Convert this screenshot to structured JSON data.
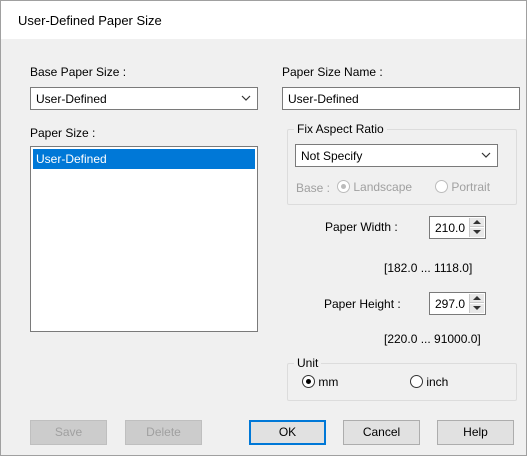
{
  "dialog": {
    "title": "User-Defined Paper Size"
  },
  "base_paper_size": {
    "label": "Base Paper Size :",
    "selected": "User-Defined"
  },
  "paper_size": {
    "label": "Paper Size :",
    "items": [
      "User-Defined"
    ]
  },
  "paper_size_name": {
    "label": "Paper Size Name :",
    "value": "User-Defined"
  },
  "fix_aspect_ratio": {
    "title": "Fix Aspect Ratio",
    "selected": "Not Specify",
    "base_label": "Base :",
    "landscape_label": "Landscape",
    "portrait_label": "Portrait"
  },
  "paper_width": {
    "label": "Paper Width :",
    "value": "210.0",
    "range": "[182.0 ... 1118.0]"
  },
  "paper_height": {
    "label": "Paper Height :",
    "value": "297.0",
    "range": "[220.0 ... 91000.0]"
  },
  "unit": {
    "title": "Unit",
    "mm_label": "mm",
    "inch_label": "inch",
    "selected": "mm"
  },
  "buttons": {
    "save": "Save",
    "delete": "Delete",
    "ok": "OK",
    "cancel": "Cancel",
    "help": "Help"
  },
  "colors": {
    "selection": "#0078d7",
    "dialog_bg": "#f0f0f0",
    "disabled_text": "#a0a0a0"
  }
}
